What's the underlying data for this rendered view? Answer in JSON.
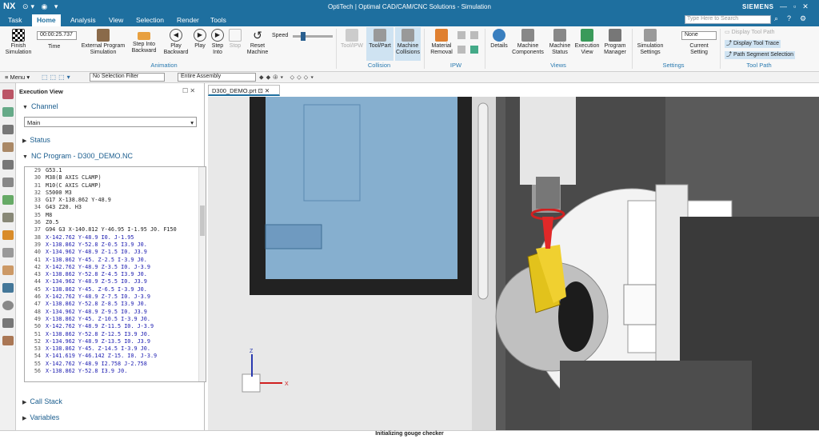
{
  "app": {
    "logo": "NX",
    "title": "OptiTech | Optimal CAD/CAM/CNC Solutions - Simulation",
    "brand": "SIEMENS"
  },
  "menu": {
    "tabs": [
      "Task",
      "Home",
      "Analysis",
      "View",
      "Selection",
      "Render",
      "Tools"
    ],
    "active": "Home",
    "search_placeholder": "Type Here to Search"
  },
  "ribbon": {
    "finish": "Finish Simulation",
    "time": "00:00:25.737",
    "time_label": "Time",
    "ext": "External Program Simulation",
    "step_into_back": "Step Into Backward",
    "play_back": "Play Backward",
    "play": "Play",
    "step_into": "Step Into",
    "stop": "Stop",
    "reset": "Reset Machine",
    "speed": "Speed",
    "animation": "Animation",
    "toolipw": "Tool/IPW",
    "toolpart": "Tool/Part",
    "machcoll": "Machine Collisions",
    "collision": "Collision",
    "matrem": "Material Removal",
    "ipw": "IPW",
    "details": "Details",
    "machcomp": "Machine Components",
    "machstat": "Machine Status",
    "execview": "Execution View",
    "progman": "Program Manager",
    "views": "Views",
    "simset": "Simulation Settings",
    "none": "None",
    "cursetting": "Current Setting",
    "settings": "Settings",
    "disptp": "Display Tool Path",
    "disptt": "Display Tool Trace",
    "pathseg": "Path Segment Selection",
    "toolpath": "Tool Path"
  },
  "toolbar2": {
    "menu": "Menu",
    "filter": "No Selection Filter",
    "assembly": "Entire Assembly"
  },
  "panel": {
    "title": "Execution View",
    "channel": "Channel",
    "channel_value": "Main",
    "status": "Status",
    "ncprog": "NC Program - D300_DEMO.NC",
    "callstack": "Call Stack",
    "variables": "Variables"
  },
  "code": [
    [
      "29",
      "G53.1"
    ],
    [
      "30",
      "M38(B AXIS CLAMP)"
    ],
    [
      "31",
      "M10(C AXIS CLAMP)"
    ],
    [
      "32",
      "S5000 M3"
    ],
    [
      "33",
      "G17 X-138.862 Y-48.9"
    ],
    [
      "34",
      "G43 Z20. H3"
    ],
    [
      "35",
      "M8"
    ],
    [
      "36",
      "Z0.5"
    ],
    [
      "37",
      "G94 G3 X-140.812 Y-46.95 I-1.95 J0. F150"
    ],
    [
      "38",
      "X-142.762 Y-48.9 I0. J-1.95"
    ],
    [
      "39",
      "X-138.862 Y-52.8 Z-0.5 I3.9 J0."
    ],
    [
      "40",
      "X-134.962 Y-48.9 Z-1.5 I0. J3.9"
    ],
    [
      "41",
      "X-138.862 Y-45. Z-2.5 I-3.9 J0."
    ],
    [
      "42",
      "X-142.762 Y-48.9 Z-3.5 I0. J-3.9"
    ],
    [
      "43",
      "X-138.862 Y-52.8 Z-4.5 I3.9 J0."
    ],
    [
      "44",
      "X-134.962 Y-48.9 Z-5.5 I0. J3.9"
    ],
    [
      "45",
      "X-138.862 Y-45. Z-6.5 I-3.9 J0."
    ],
    [
      "46",
      "X-142.762 Y-48.9 Z-7.5 I0. J-3.9"
    ],
    [
      "47",
      "X-138.862 Y-52.8 Z-8.5 I3.9 J0."
    ],
    [
      "48",
      "X-134.962 Y-48.9 Z-9.5 I0. J3.9"
    ],
    [
      "49",
      "X-138.862 Y-45. Z-10.5 I-3.9 J0."
    ],
    [
      "50",
      "X-142.762 Y-48.9 Z-11.5 I0. J-3.9"
    ],
    [
      "51",
      "X-138.862 Y-52.8 Z-12.5 I3.9 J0."
    ],
    [
      "52",
      "X-134.962 Y-48.9 Z-13.5 I0. J3.9"
    ],
    [
      "53",
      "X-138.862 Y-45. Z-14.5 I-3.9 J0."
    ],
    [
      "54",
      "X-141.619 Y-46.142 Z-15. I0. J-3.9"
    ],
    [
      "55",
      "X-142.762 Y-48.9 I2.758 J-2.758"
    ],
    [
      "56",
      "X-138.862 Y-52.8 I3.9 J0."
    ]
  ],
  "viewport": {
    "tab": "D300_DEMO.prt"
  },
  "status": "Initializing gouge checker"
}
